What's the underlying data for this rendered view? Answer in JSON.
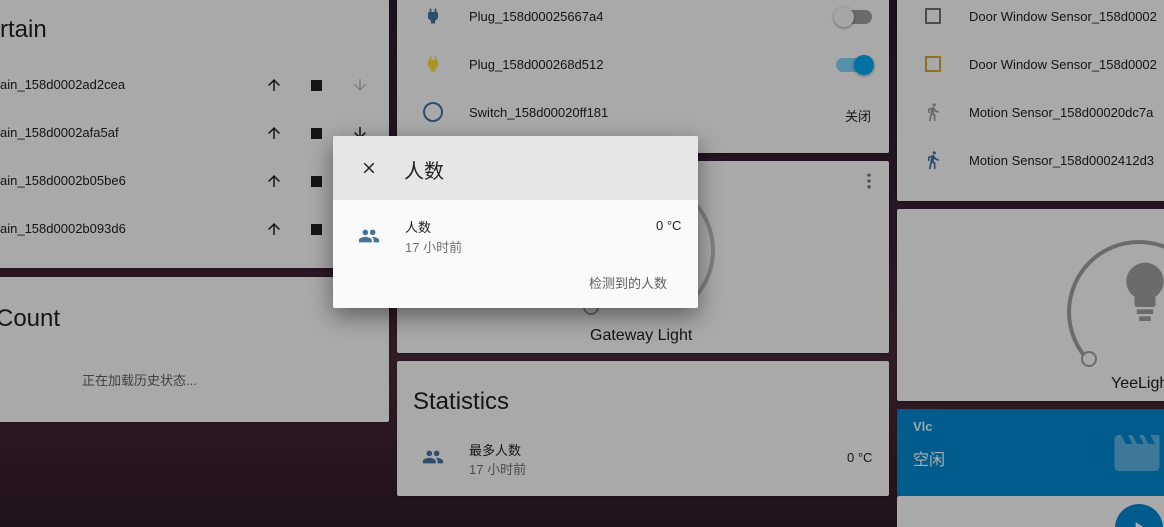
{
  "curtain_card": {
    "title": "rtain",
    "rows": [
      {
        "name": "ain_158d0002ad2cea"
      },
      {
        "name": "ain_158d0002afa5af"
      },
      {
        "name": "ain_158d0002b05be6"
      },
      {
        "name": "ain_158d0002b093d6"
      }
    ]
  },
  "count_card": {
    "title": "Count",
    "loading_text": "正在加载历史状态..."
  },
  "switches_card": {
    "rows": [
      {
        "name": "Plug_158d00025667a4",
        "state": "off"
      },
      {
        "name": "Plug_158d000268d512",
        "state": "on"
      },
      {
        "name": "Switch_158d00020ff181",
        "state_text": "关闭"
      }
    ]
  },
  "gateway_light_card": {
    "name": "Gateway Light"
  },
  "statistics_card": {
    "title": "Statistics",
    "row": {
      "name": "最多人数",
      "time": "17 小时前",
      "value": "0 °C"
    }
  },
  "sensors_card": {
    "rows": [
      {
        "name": "Door Window Sensor_158d0002"
      },
      {
        "name": "Door Window Sensor_158d0002"
      },
      {
        "name": "Motion Sensor_158d00020dc7a"
      },
      {
        "name": "Motion Sensor_158d0002412d3"
      }
    ]
  },
  "yeelight_card": {
    "name": "YeeLigh"
  },
  "vlc_card": {
    "title": "Vlc",
    "state": "空闲"
  },
  "dialog": {
    "title": "人数",
    "entity_name": "人数",
    "entity_time": "17 小时前",
    "entity_value": "0 °C",
    "footer_text": "检测到的人数"
  },
  "colors": {
    "accent": "#03a9f4",
    "icon_blue": "#44739e",
    "plug_on": "#fdd835",
    "door_yellow": "#d4a72c",
    "vlc_bg": "#0288d1"
  }
}
